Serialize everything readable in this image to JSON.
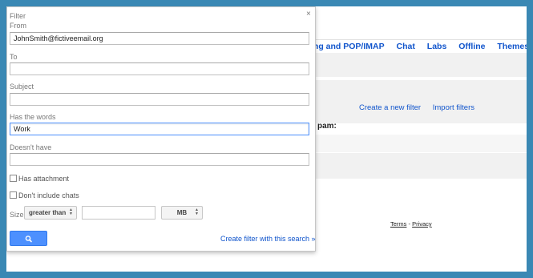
{
  "background": {
    "tabs": [
      "ing and POP/IMAP",
      "Chat",
      "Labs",
      "Offline",
      "Themes"
    ],
    "links": [
      "Create a new filter",
      "Import filters"
    ],
    "spam_fragment": "pam:",
    "footer": {
      "terms": "Terms",
      "sep": " - ",
      "privacy": "Privacy"
    }
  },
  "dialog": {
    "title": "Filter",
    "close": "×",
    "from": {
      "label": "From",
      "value": "JohnSmith@fictiveemail.org"
    },
    "to": {
      "label": "To",
      "value": ""
    },
    "subject": {
      "label": "Subject",
      "value": ""
    },
    "has_words": {
      "label": "Has the words",
      "value": "Work"
    },
    "doesnt_have": {
      "label": "Doesn't have",
      "value": ""
    },
    "has_attachment": "Has attachment",
    "dont_include_chats": "Don't include chats",
    "size": {
      "label": "Size",
      "comparator": "greater than",
      "value": "",
      "unit": "MB"
    },
    "create_link": "Create filter with this search »",
    "search_button_icon": "search-icon"
  },
  "colors": {
    "accent": "#4d90fe",
    "link": "#1155cc",
    "frame": "#3a88b4"
  }
}
